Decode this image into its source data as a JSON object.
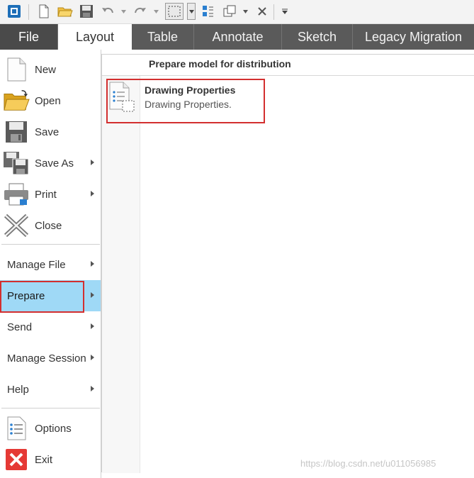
{
  "ribbon": {
    "tabs": [
      {
        "label": "File"
      },
      {
        "label": "Layout"
      },
      {
        "label": "Table"
      },
      {
        "label": "Annotate"
      },
      {
        "label": "Sketch"
      },
      {
        "label": "Legacy Migration"
      }
    ],
    "active_tab": "Layout"
  },
  "quick_access": {
    "icons": [
      "app-icon",
      "new-icon",
      "open-icon",
      "save-icon",
      "undo-icon",
      "redo-icon",
      "select-box-icon",
      "regenerate-icon",
      "windows-icon",
      "close-window-icon",
      "customize-icon"
    ]
  },
  "file_menu": {
    "items": [
      {
        "label": "New",
        "icon": "new-file-icon",
        "submenu": false
      },
      {
        "label": "Open",
        "icon": "open-folder-icon",
        "submenu": false
      },
      {
        "label": "Save",
        "icon": "save-icon",
        "submenu": false
      },
      {
        "label": "Save As",
        "icon": "save-as-icon",
        "submenu": true
      },
      {
        "label": "Print",
        "icon": "printer-icon",
        "submenu": true
      },
      {
        "label": "Close",
        "icon": "close-x-icon",
        "submenu": false
      },
      {
        "label": "Manage File",
        "submenu": true
      },
      {
        "label": "Prepare",
        "submenu": true,
        "selected": true
      },
      {
        "label": "Send",
        "submenu": true
      },
      {
        "label": "Manage Session",
        "submenu": true
      },
      {
        "label": "Help",
        "submenu": true
      },
      {
        "label": "Options",
        "icon": "options-list-icon",
        "submenu": false
      },
      {
        "label": "Exit",
        "icon": "exit-red-x-icon",
        "submenu": false
      }
    ]
  },
  "prepare_panel": {
    "title": "Prepare model for distribution",
    "items": [
      {
        "title": "Drawing Properties",
        "description": "Drawing Properties.",
        "icon": "drawing-properties-icon"
      }
    ]
  },
  "watermark": "https://blog.csdn.net/u011056985",
  "colors": {
    "tab_bar": "#5a5a5a",
    "selected_item": "#9fd9f6",
    "highlight_box": "#d32f2f"
  }
}
